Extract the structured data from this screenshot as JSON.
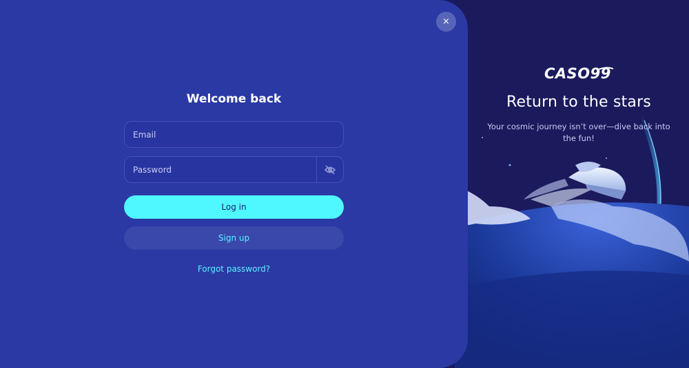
{
  "modal": {
    "close_glyph": "×",
    "title": "Welcome back",
    "email": {
      "placeholder": "Email",
      "value": ""
    },
    "password": {
      "placeholder": "Password",
      "value": ""
    },
    "login_label": "Log in",
    "signup_label": "Sign up",
    "forgot_label": "Forgot password?"
  },
  "hero": {
    "brand": "CASO99",
    "title": "Return to the stars",
    "subtitle": "Your cosmic journey isn’t over—dive back into the fun!"
  },
  "icons": {
    "close": "close-icon",
    "password_toggle": "eye-off-icon",
    "logo": "casoo-logo"
  },
  "colors": {
    "panel": "#2a39a4",
    "hero_bg": "#1b1a5c",
    "primary_button": "#4ff7ff",
    "secondary_button": "#3a47ab",
    "accent_text": "#5ff0ff"
  }
}
